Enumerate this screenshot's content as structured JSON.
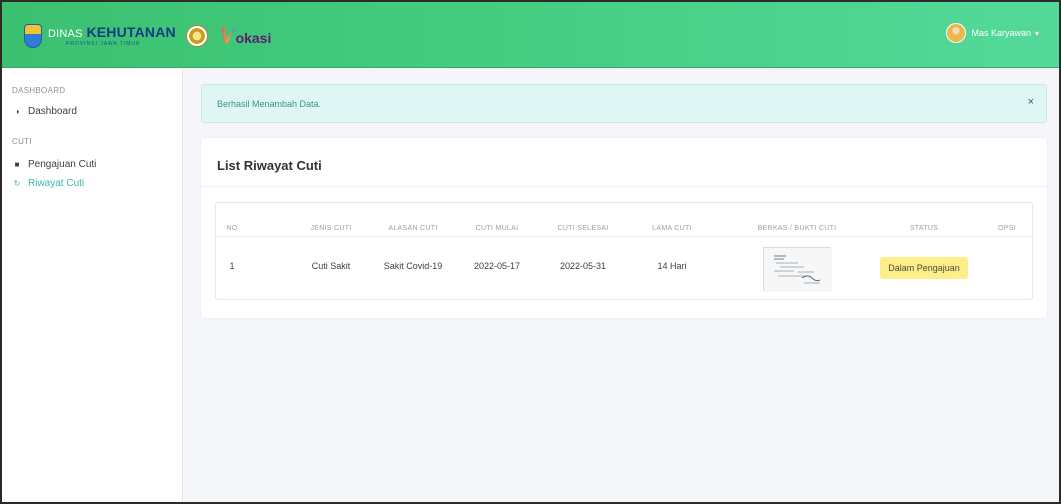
{
  "header": {
    "brand_word1": "DINAS",
    "brand_word2": "KEHUTANAN",
    "brand_sub": "PROVINSI JAWA TIMUR",
    "vokasi_v": "V",
    "vokasi_rest": "okasi",
    "user_name": "Mas Karyawan"
  },
  "sidebar": {
    "section1": "DASHBOARD",
    "item_dashboard": "Dashboard",
    "section2": "CUTI",
    "item_pengajuan": "Pengajuan Cuti",
    "item_riwayat": "Riwayat Cuti"
  },
  "alert": {
    "message": "Berhasil Menambah Data.",
    "close": "×"
  },
  "card": {
    "title": "List Riwayat Cuti"
  },
  "table": {
    "headers": [
      "NO",
      "JENIS CUTI",
      "ALASAN CUTI",
      "CUTI MULAI",
      "CUTI SELESAI",
      "LAMA CUTI",
      "BERKAS / BUKTI CUTI",
      "STATUS",
      "OPSI"
    ],
    "rows": [
      {
        "no": "1",
        "jenis": "Cuti Sakit",
        "alasan": "Sakit Covid-19",
        "mulai": "2022-05-17",
        "selesai": "2022-05-31",
        "lama": "14 Hari",
        "status": "Dalam Pengajuan"
      }
    ]
  },
  "colors": {
    "topbar": "#45cc80",
    "accent": "#36b8a8",
    "alert_bg": "#dff6f4",
    "status_badge": "#fdee8a"
  },
  "icons": {
    "dashboard": "palette-icon",
    "pengajuan": "document-icon",
    "riwayat": "history-icon"
  }
}
